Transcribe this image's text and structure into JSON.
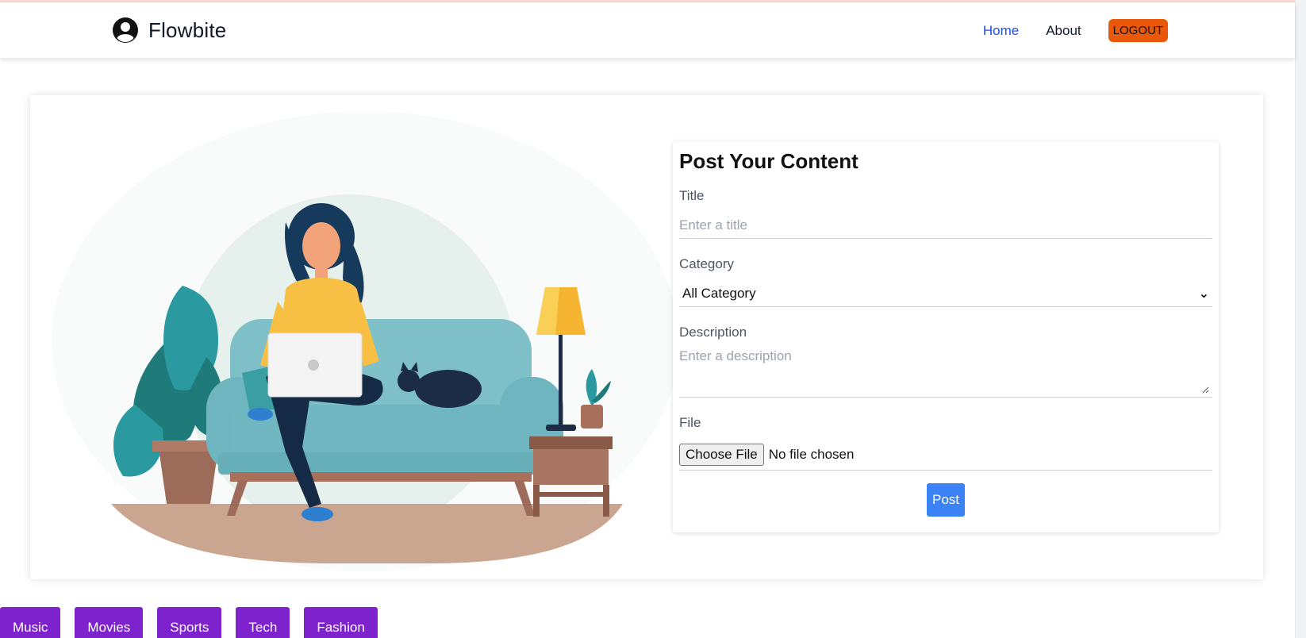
{
  "brand": {
    "name": "Flowbite",
    "icon": "user-circle-icon"
  },
  "nav": {
    "home": "Home",
    "about": "About",
    "logout": "LOGOUT"
  },
  "colors": {
    "nav_active": "#1d4ed8",
    "logout_bg": "#ea580c",
    "post_bg": "#3b82f6",
    "category_bg": "#7e22ce"
  },
  "form": {
    "title": "Post Your Content",
    "title_label": "Title",
    "title_placeholder": "Enter a title",
    "category_label": "Category",
    "category_selected": "All Category",
    "description_label": "Description",
    "description_placeholder": "Enter a description",
    "file_label": "File",
    "choose_file": "Choose File",
    "file_status": "No file chosen",
    "post": "Post"
  },
  "categories": [
    "Music",
    "Movies",
    "Sports",
    "Tech",
    "Fashion"
  ]
}
